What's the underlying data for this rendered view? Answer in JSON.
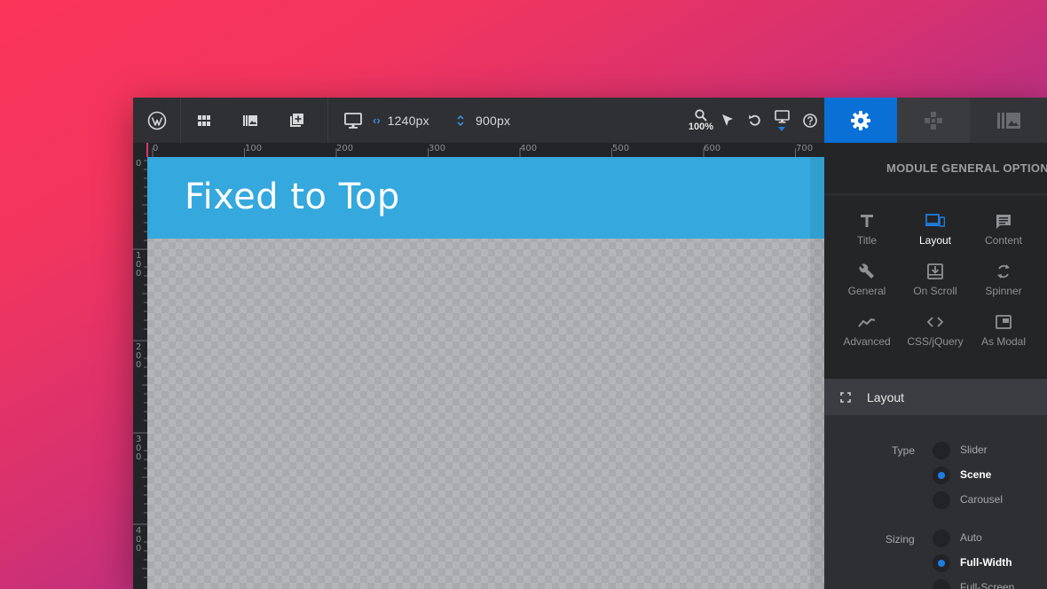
{
  "toolbar": {
    "width_value": "1240px",
    "height_value": "900px",
    "zoom": "100%"
  },
  "ruler": {
    "top_ticks": [
      "0",
      "100",
      "200",
      "300",
      "400",
      "500",
      "600",
      "700"
    ],
    "left_ticks": [
      "0",
      "100",
      "200",
      "300",
      "400"
    ]
  },
  "canvas": {
    "banner_title": "Fixed to Top",
    "banner_color": "#35a8de"
  },
  "panel": {
    "title": "MODULE GENERAL OPTIONS",
    "options": [
      {
        "label": "Title",
        "icon": "text-t-icon",
        "active": false
      },
      {
        "label": "Layout",
        "icon": "devices-icon",
        "active": true
      },
      {
        "label": "Content",
        "icon": "message-icon",
        "active": false
      },
      {
        "label": "General",
        "icon": "wrench-icon",
        "active": false
      },
      {
        "label": "On Scroll",
        "icon": "download-box-icon",
        "active": false
      },
      {
        "label": "Spinner",
        "icon": "refresh-icon",
        "active": false
      },
      {
        "label": "Advanced",
        "icon": "trend-icon",
        "active": false
      },
      {
        "label": "CSS/jQuery",
        "icon": "code-icon",
        "active": false
      },
      {
        "label": "As Modal",
        "icon": "modal-window-icon",
        "active": false
      }
    ],
    "section_title": "Layout",
    "type": {
      "label": "Type",
      "options": [
        "Slider",
        "Scene",
        "Carousel"
      ],
      "selected": "Scene"
    },
    "sizing": {
      "label": "Sizing",
      "options": [
        "Auto",
        "Full-Width",
        "Full-Screen"
      ],
      "selected": "Full-Width"
    }
  },
  "colors": {
    "accent": "#1e7de0",
    "active_tab": "#0a70d6"
  }
}
